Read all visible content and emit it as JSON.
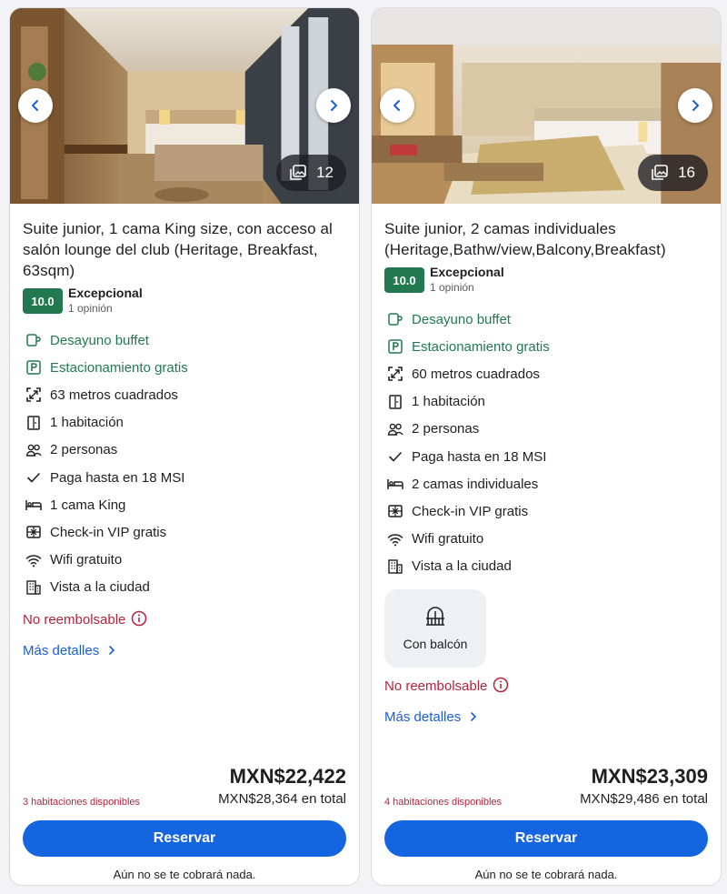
{
  "rooms": [
    {
      "photo_count": "12",
      "title": "Suite junior, 1 cama King size, con acceso al salón lounge del club (Heritage, Breakfast, 63sqm)",
      "rating": {
        "score": "10.0",
        "label": "Excepcional",
        "reviews": "1 opinión"
      },
      "features": [
        {
          "icon": "coffee-cup-icon",
          "text": "Desayuno buffet",
          "highlight": true
        },
        {
          "icon": "parking-icon",
          "text": "Estacionamiento gratis",
          "highlight": true
        },
        {
          "icon": "area-size-icon",
          "text": "63 metros cuadrados",
          "highlight": false
        },
        {
          "icon": "door-icon",
          "text": "1 habitación",
          "highlight": false
        },
        {
          "icon": "people-icon",
          "text": "2 personas",
          "highlight": false
        },
        {
          "icon": "checkmark-icon",
          "text": "Paga hasta en 18 MSI",
          "highlight": false
        },
        {
          "icon": "bed-icon",
          "text": "1 cama King",
          "highlight": false
        },
        {
          "icon": "vip-ticket-icon",
          "text": "Check-in VIP gratis",
          "highlight": false
        },
        {
          "icon": "wifi-icon",
          "text": "Wifi gratuito",
          "highlight": false
        },
        {
          "icon": "city-building-icon",
          "text": "Vista a la ciudad",
          "highlight": false
        }
      ],
      "refund": "No reembolsable",
      "details_link": "Más detalles",
      "availability": "3 habitaciones disponibles",
      "price": "MXN$22,422",
      "total": "MXN$28,364 en total",
      "reserve_label": "Reservar",
      "no_charge": "Aún no se te cobrará nada."
    },
    {
      "photo_count": "16",
      "title": "Suite junior, 2 camas individuales (Heritage,Bathw/view,Balcony,Breakfast)",
      "rating": {
        "score": "10.0",
        "label": "Excepcional",
        "reviews": "1 opinión"
      },
      "features": [
        {
          "icon": "coffee-cup-icon",
          "text": "Desayuno buffet",
          "highlight": true
        },
        {
          "icon": "parking-icon",
          "text": "Estacionamiento gratis",
          "highlight": true
        },
        {
          "icon": "area-size-icon",
          "text": "60 metros cuadrados",
          "highlight": false
        },
        {
          "icon": "door-icon",
          "text": "1 habitación",
          "highlight": false
        },
        {
          "icon": "people-icon",
          "text": "2 personas",
          "highlight": false
        },
        {
          "icon": "checkmark-icon",
          "text": "Paga hasta en 18 MSI",
          "highlight": false
        },
        {
          "icon": "bed-icon",
          "text": "2 camas individuales",
          "highlight": false
        },
        {
          "icon": "vip-ticket-icon",
          "text": "Check-in VIP gratis",
          "highlight": false
        },
        {
          "icon": "wifi-icon",
          "text": "Wifi gratuito",
          "highlight": false
        },
        {
          "icon": "city-building-icon",
          "text": "Vista a la ciudad",
          "highlight": false
        }
      ],
      "balcony_label": "Con balcón",
      "refund": "No reembolsable",
      "details_link": "Más detalles",
      "availability": "4 habitaciones disponibles",
      "price": "MXN$23,309",
      "total": "MXN$29,486 en total",
      "reserve_label": "Reservar",
      "no_charge": "Aún no se te cobrará nada."
    }
  ],
  "colors": {
    "accent": "#1565e0",
    "rating_green": "#227950",
    "warning_red": "#b3253d",
    "link_blue": "#1a5fd4"
  }
}
